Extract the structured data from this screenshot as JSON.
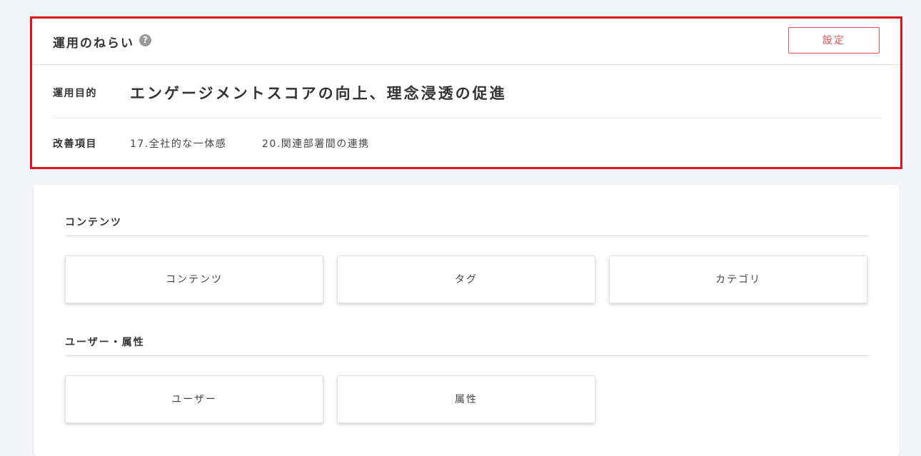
{
  "aims": {
    "title": "運用のねらい",
    "help_icon": "question-circle-icon",
    "settings_label": "設定",
    "purpose_label": "運用目的",
    "purpose_value": "エンゲージメントスコアの向上、理念浸透の促進",
    "improvement_label": "改善項目",
    "improvement_items": [
      "17.全社的な一体感",
      "20.関連部署間の連携"
    ]
  },
  "sections": [
    {
      "title": "コンテンツ",
      "tiles": [
        "コンテンツ",
        "タグ",
        "カテゴリ"
      ]
    },
    {
      "title": "ユーザー・属性",
      "tiles": [
        "ユーザー",
        "属性"
      ]
    }
  ],
  "colors": {
    "highlight_border": "#e0141e",
    "settings_accent": "#e0505a",
    "background": "#f4f5f8"
  }
}
